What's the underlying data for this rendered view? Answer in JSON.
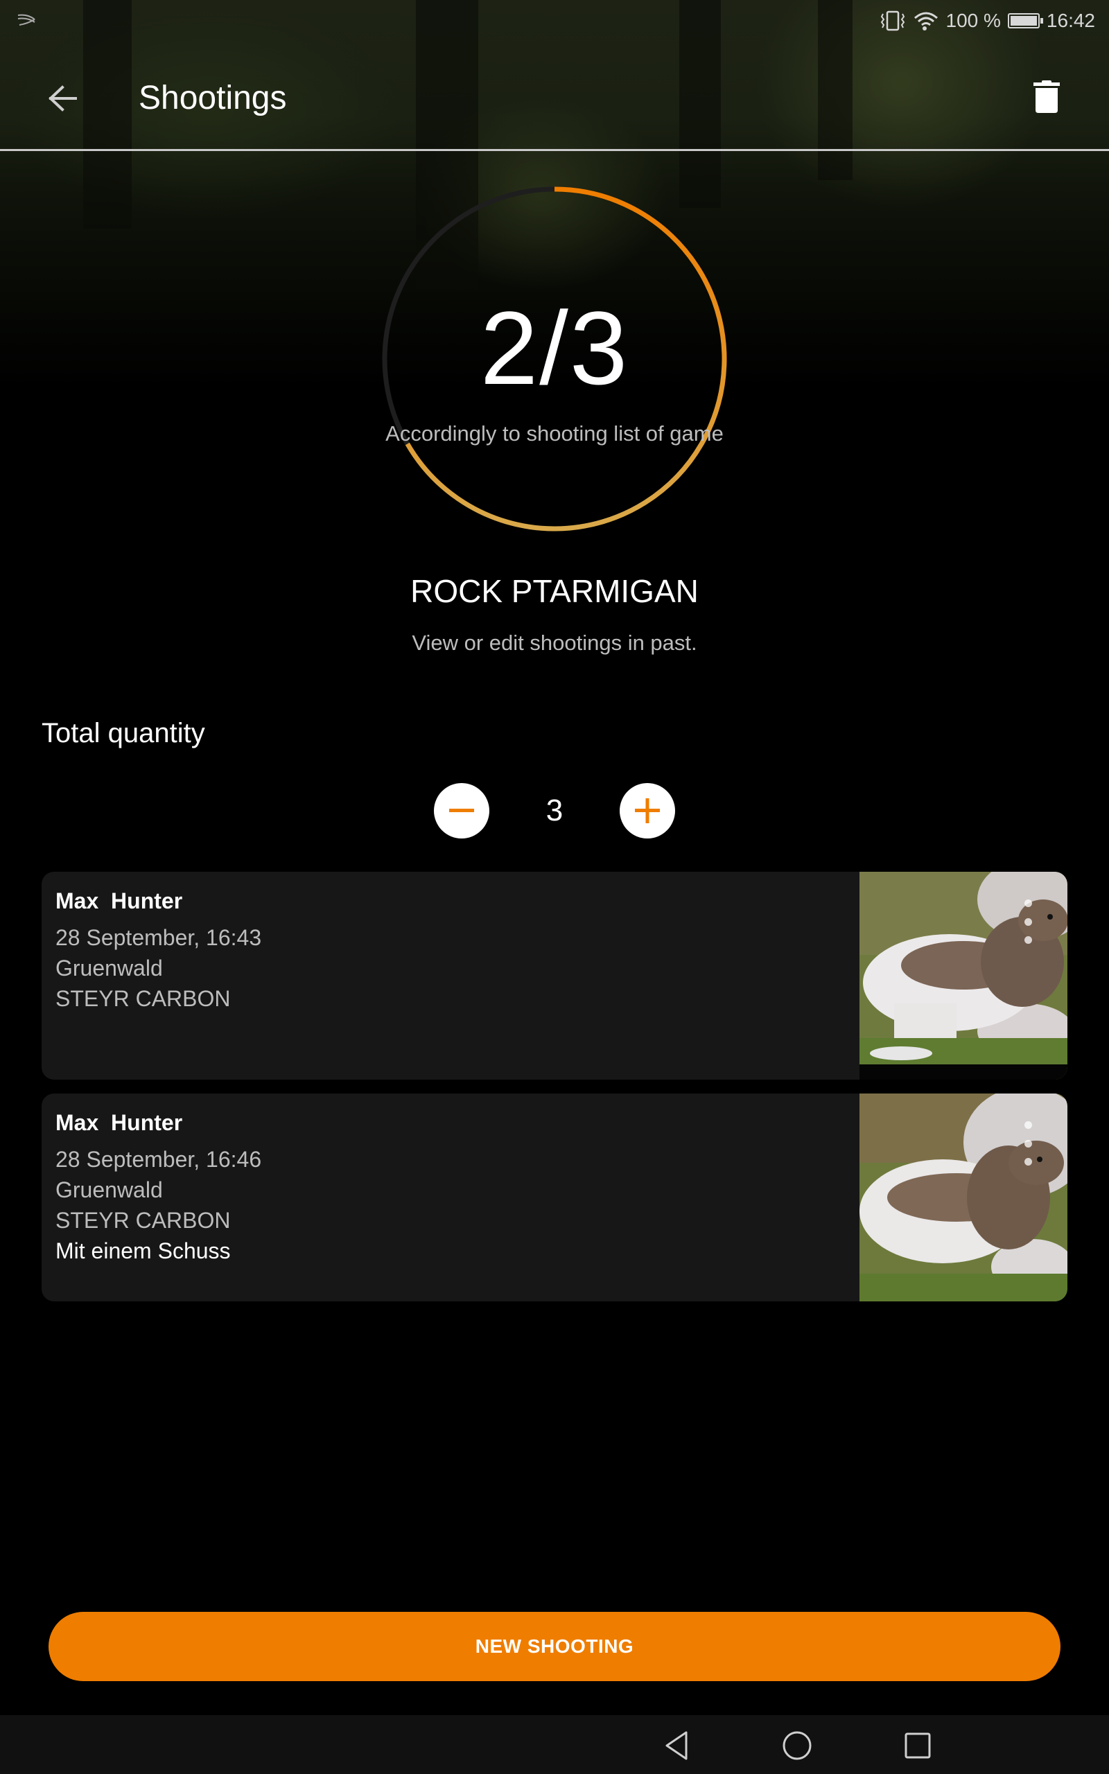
{
  "status_bar": {
    "battery_text": "100 %",
    "battery_level_percent": 100,
    "time": "16:42",
    "icons": [
      "swiftkey-icon",
      "vibrate-icon",
      "wifi-icon",
      "battery-icon"
    ]
  },
  "app_bar": {
    "title": "Shootings",
    "back_icon": "arrow-left-icon",
    "delete_icon": "trash-icon"
  },
  "progress": {
    "count_text": "2/3",
    "done": 2,
    "total": 3,
    "fraction": 0.667,
    "caption": "Accordingly to shooting list of game",
    "colors": {
      "start": "#ef7d00",
      "end": "#d9a94a",
      "track": "#1e1e1e"
    }
  },
  "species": {
    "title": "ROCK PTARMIGAN",
    "subtitle": "View or edit shootings in past."
  },
  "quantity": {
    "label": "Total quantity",
    "value": "3",
    "decrement_icon": "minus-icon",
    "increment_icon": "plus-icon"
  },
  "shootings": [
    {
      "hunter": "Max  Hunter",
      "datetime": "28 September, 16:43",
      "location": "Gruenwald",
      "weapon": "STEYR CARBON",
      "note": "",
      "photo": "rock-ptarmigan-photo"
    },
    {
      "hunter": "Max  Hunter",
      "datetime": "28 September, 16:46",
      "location": "Gruenwald",
      "weapon": "STEYR CARBON",
      "note": "Mit einem Schuss",
      "photo": "rock-ptarmigan-photo"
    }
  ],
  "actions": {
    "new_shooting_label": "NEW SHOOTING"
  },
  "nav_bar": {
    "icons": [
      "back-triangle-icon",
      "home-circle-icon",
      "recents-square-icon"
    ]
  },
  "colors": {
    "accent": "#ef7d00",
    "background": "#000000",
    "card": "#171717",
    "secondary_text": "#bdbdbd"
  }
}
